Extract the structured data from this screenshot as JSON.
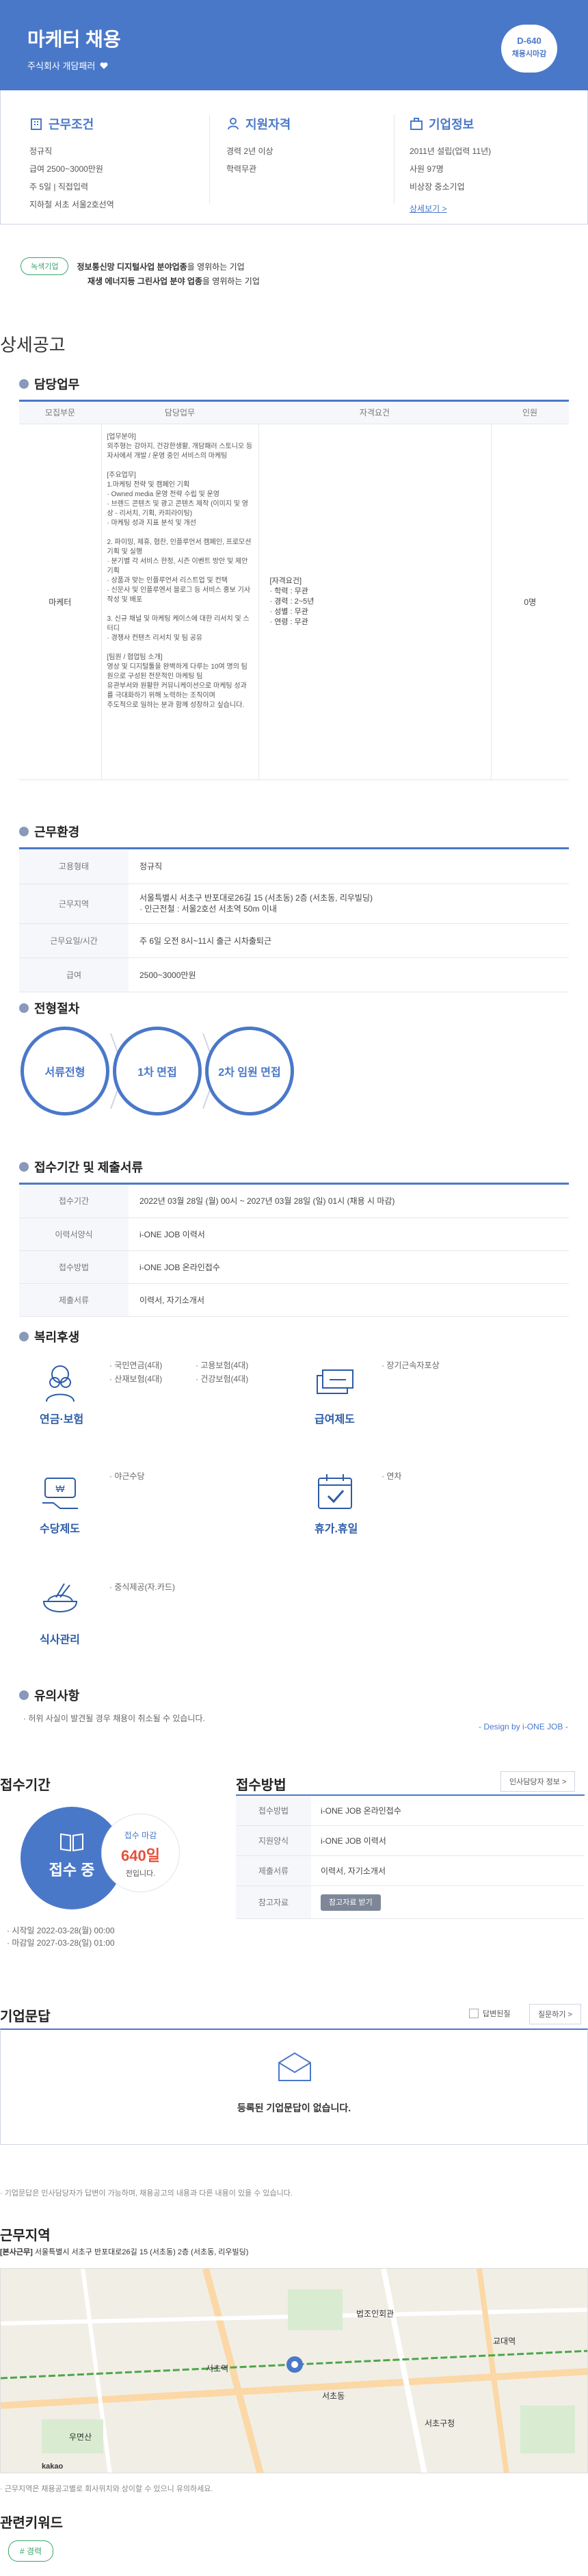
{
  "hero": {
    "title": "마케터 채용",
    "company": "주식회사 개담패러",
    "dday": "D-640",
    "dday_sub": "채용시마감"
  },
  "summary": {
    "conditions": {
      "title": "근무조건",
      "items": [
        "정규직",
        "급여 2500~3000만원",
        "주 5일 | 직접입력",
        "지하철 서초 서울2호선역"
      ]
    },
    "qualifications": {
      "title": "지원자격",
      "items": [
        "경력 2년 이상",
        "학력무관"
      ]
    },
    "company_info": {
      "title": "기업정보",
      "items": [
        "2011년 설립(업력 11년)",
        "사원 97명",
        "비상장 중소기업"
      ],
      "link": "상세보기 >"
    }
  },
  "badges": {
    "tag": "녹색기업",
    "line1_bold": "정보통신망 디지털사업 분야업종",
    "line1_rest": "을 영위하는 기업",
    "line2_bold": "재생 에너지등 그린사업 분야 업종",
    "line2_rest": "을 영위하는 기업"
  },
  "detail_heading": "상세공고",
  "duties": {
    "title": "담당업무",
    "headers": [
      "모집부문",
      "담당업무",
      "자격요건",
      "인원"
    ],
    "row": {
      "part": "마케터",
      "work": "[업무분야]\n외주형는 강아지, 건강한생활, 개담패러 스토니오 등 자사에서 개발 / 운영 중인 서비스의 마케팅\n\n[주요업무]\n1.마케팅 전략 및 캠페인 기획\n · Owned media 운영 전략 수립 및 운영\n · 브랜드 콘텐츠 및 광고 콘텐츠 제작 (이미지 및 영상 - 리서치, 기획, 카피라이팅)\n · 마케팅 성과 지표 분석 및 개선\n\n2. 파이밍, 제휴, 협찬, 인플루언서 캠페인, 프로모션 기획 및 실행\n · 분기별 각 서비스 한정, 시즌 이벤트 방안 및 제안 기획\n · 상품과 맞는 인플루언서 리스트업 및 컨택\n · 신문사 및 인플루엔서 블로그 등 서비스 홍보 기사 작성 및 배포\n\n3. 신규 채널 및 마케팅 케이스에 대한 리서치 및 스터디\n · 경쟁사 컨텐츠 리서치 및 팀 공유\n\n[팀원 / 협업팀 소개]\n영상 및 디지털툴을 완벽하게 다루는 10여 명의 팀원으로 구성된 전문적인 마케팅 팀\n유관부서와 원활한 커뮤니케이션으로 마케팅 성과를 극대화하기 위해 노력하는 조직이며\n주도적으로 일하는 분과 함께 성장하고 싶습니다.",
      "req": "[자격요건]\n · 학력 : 무관\n · 경력 : 2~5년\n · 성별 : 무관\n · 연령 : 무관",
      "count": "0명"
    }
  },
  "environment": {
    "title": "근무환경",
    "rows": [
      {
        "label": "고용형태",
        "value": "정규직"
      },
      {
        "label": "근무지역",
        "value": "서울특별시 서초구 반포대로26길 15 (서초동) 2층 (서초동, 리우빌딩)\n· 인근전철 : 서울2호선 서초역 50m 이내"
      },
      {
        "label": "근무요일/시간",
        "value": "주 6일 오전 8시~11시 출근 시차출퇴근"
      },
      {
        "label": "급여",
        "value": "2500~3000만원"
      }
    ]
  },
  "process": {
    "title": "전형절차",
    "steps": [
      "서류전형",
      "1차 면접",
      "2차 임원 면접"
    ]
  },
  "period": {
    "title": "접수기간 및 제출서류",
    "rows": [
      {
        "label": "접수기간",
        "value": "2022년 03월 28일 (월) 00시 ~ 2027년 03월 28일 (일) 01시 (채용 시 마감)"
      },
      {
        "label": "이력서양식",
        "value": "i-ONE JOB 이력서"
      },
      {
        "label": "접수방법",
        "value": "i-ONE JOB 온라인접수"
      },
      {
        "label": "제출서류",
        "value": "이력서, 자기소개서"
      }
    ]
  },
  "welfare": {
    "title": "복리후생",
    "items": [
      {
        "label": "연금·보험",
        "icon": "glasses-person-icon",
        "bullets": [
          "· 국민연금(4대)",
          "· 고용보험(4대)",
          "· 산재보험(4대)",
          "· 건강보험(4대)"
        ]
      },
      {
        "label": "급여제도",
        "icon": "money-icon",
        "bullets": [
          "· 장기근속자포상"
        ]
      },
      {
        "label": "수당제도",
        "icon": "wallet-hand-icon",
        "bullets": [
          "· 야근수당"
        ]
      },
      {
        "label": "휴가.휴일",
        "icon": "calendar-check-icon",
        "bullets": [
          "· 연차"
        ]
      },
      {
        "label": "식사관리",
        "icon": "rice-bowl-icon",
        "bullets": [
          "· 중식제공(자.카드)"
        ]
      }
    ]
  },
  "notice": {
    "title": "유의사항",
    "text": "· 허위 사실이 발견될 경우 채용이 취소될 수 있습니다.",
    "design_by": "- Design by i-ONE JOB -"
  },
  "receipt": {
    "title": "접수기간",
    "status": "접수 중",
    "deadline_label": "접수 마감",
    "days": "640일",
    "days_sub": "전입니다.",
    "start": "· 시작일 2022-03-28(월) 00:00",
    "end": "· 마감일 2027-03-28(일) 01:00"
  },
  "method": {
    "title": "접수방법",
    "hr_button": "인사담당자 정보 >",
    "rows": [
      {
        "label": "접수방법",
        "value": "i-ONE JOB 온라인접수"
      },
      {
        "label": "지원양식",
        "value": "i-ONE JOB 이력서"
      },
      {
        "label": "제출서류",
        "value": "이력서, 자기소개서"
      },
      {
        "label": "참고자료",
        "value": "참고자료 받기"
      }
    ]
  },
  "qa": {
    "title": "기업문답",
    "answer_toggle": "답변된질",
    "ask_button": "질문하기 >",
    "empty": "등록된 기업문답이 없습니다.",
    "note": "· 기업문답은 인사담당자가 답변이 가능하며, 채용공고의 내용과 다른 내용이 있을 수 있습니다."
  },
  "location": {
    "title": "근무지역",
    "address_tag": "[본사근무]",
    "address": "서울특별시 서초구 반포대로26길 15 (서초동) 2층 (서초동, 리우빌딩)",
    "map_note": "· 근무지역은 채용공고별로 회사위치와 상이할 수 있으니 유의하세요.",
    "map_labels": [
      "서초역",
      "서초동",
      "법조인회관",
      "서초구청",
      "교대역",
      "우면산",
      "kakao"
    ]
  },
  "keywords": {
    "title": "관련키워드",
    "items": [
      "# 경력"
    ]
  }
}
